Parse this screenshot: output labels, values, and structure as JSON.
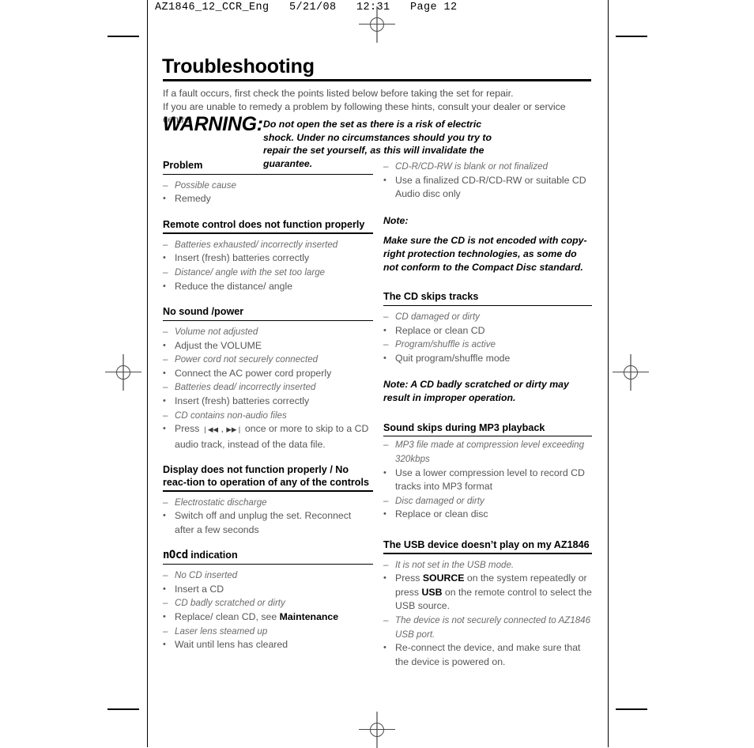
{
  "header": {
    "line": "AZ1846_12_CCR_Eng   5/21/08   12:31   Page 12"
  },
  "title": "Troubleshooting",
  "intro": {
    "line1": "If a fault occurs, first check the points listed below before taking the set for repair.",
    "line2": "If you are unable to remedy a problem by following these hints, consult your dealer or service centre."
  },
  "warning": {
    "label": "WARNING:",
    "text": "Do not open the set as there is a risk of electric shock. Under no circumstances should you try to repair the set yourself, as this will invalidate the guarantee."
  },
  "markers": {
    "cause": "–",
    "remedy": "•"
  },
  "left_column": {
    "sections": [
      {
        "heading": "Problem",
        "items": [
          {
            "type": "cause",
            "text": "Possible cause"
          },
          {
            "type": "remedy",
            "text": "Remedy"
          }
        ]
      },
      {
        "heading": "Remote control does not function properly",
        "items": [
          {
            "type": "cause",
            "text": "Batteries exhausted/ incorrectly inserted"
          },
          {
            "type": "remedy",
            "text": "Insert (fresh) batteries correctly"
          },
          {
            "type": "cause",
            "text": "Distance/ angle with the set too large"
          },
          {
            "type": "remedy",
            "text": "Reduce the distance/ angle"
          }
        ]
      },
      {
        "heading": "No sound /power",
        "items": [
          {
            "type": "cause",
            "text": "Volume not adjusted"
          },
          {
            "type": "remedy",
            "text": "Adjust the VOLUME"
          },
          {
            "type": "cause",
            "text": "Power cord not securely connected"
          },
          {
            "type": "remedy",
            "text": "Connect the AC power cord properly"
          },
          {
            "type": "cause",
            "text": "Batteries dead/ incorrectly inserted"
          },
          {
            "type": "remedy",
            "text": "Insert (fresh) batteries correctly"
          },
          {
            "type": "cause",
            "text": "CD contains non-audio files"
          },
          {
            "type": "remedy",
            "text": "Press ❘◀◀ , ▶▶❘ once or more to skip to a CD audio track, instead of the data file."
          }
        ]
      },
      {
        "heading": "Display does not function properly / No reac-tion to operation of any of the controls",
        "items": [
          {
            "type": "cause",
            "text": "Electrostatic discharge"
          },
          {
            "type": "remedy",
            "text": "Switch off and unplug the set. Reconnect after a few seconds"
          }
        ]
      },
      {
        "heading_lcd": "nOcd",
        "heading_suffix": "indication",
        "items": [
          {
            "type": "cause",
            "text": "No CD inserted"
          },
          {
            "type": "remedy",
            "text": "Insert a CD"
          },
          {
            "type": "cause",
            "text": "CD badly scratched or dirty"
          },
          {
            "type": "remedy",
            "text": "Replace/ clean CD, see ",
            "bold_tail": "Maintenance"
          },
          {
            "type": "cause",
            "text": "Laser lens steamed up"
          },
          {
            "type": "remedy",
            "text": "Wait until lens has cleared"
          }
        ]
      }
    ]
  },
  "right_column": {
    "top_items": [
      {
        "type": "cause",
        "text": "CD-R/CD-RW is blank or not finalized"
      },
      {
        "type": "remedy",
        "text": "Use a finalized CD-R/CD-RW or suitable CD Audio disc only"
      }
    ],
    "note_label": "Note:",
    "note_body": "Make sure the CD is not encoded with copy-right protection technologies, as some do not conform to the Compact Disc standard.",
    "sections": [
      {
        "heading": "The CD skips tracks",
        "items": [
          {
            "type": "cause",
            "text": "CD damaged or dirty"
          },
          {
            "type": "remedy",
            "text": "Replace or clean CD"
          },
          {
            "type": "cause",
            "text": "Program/shuffle is active"
          },
          {
            "type": "remedy",
            "text": "Quit program/shuffle mode"
          }
        ],
        "note": "Note: A CD badly scratched or dirty may result in improper operation."
      },
      {
        "heading": "Sound skips during MP3 playback",
        "items": [
          {
            "type": "cause",
            "text": "MP3 file made at compression level exceeding 320kbps"
          },
          {
            "type": "remedy",
            "text": "Use a lower compression level to record CD tracks into MP3 format"
          },
          {
            "type": "cause",
            "text": "Disc damaged or dirty"
          },
          {
            "type": "remedy",
            "text": "Replace or clean disc"
          }
        ]
      },
      {
        "heading": "The USB device doesn’t play on my AZ1846",
        "items": [
          {
            "type": "cause",
            "text": "It is not set in the USB mode."
          },
          {
            "type": "remedy",
            "text": "Press SOURCE on the system repeatedly or press USB on the remote control to select the USB source.",
            "bold_words": [
              "SOURCE",
              "USB"
            ]
          },
          {
            "type": "cause",
            "text": "The device is not securely connected to AZ1846 USB port."
          },
          {
            "type": "remedy",
            "text": "Re-connect the device, and make sure that the device is powered on."
          }
        ]
      }
    ]
  }
}
